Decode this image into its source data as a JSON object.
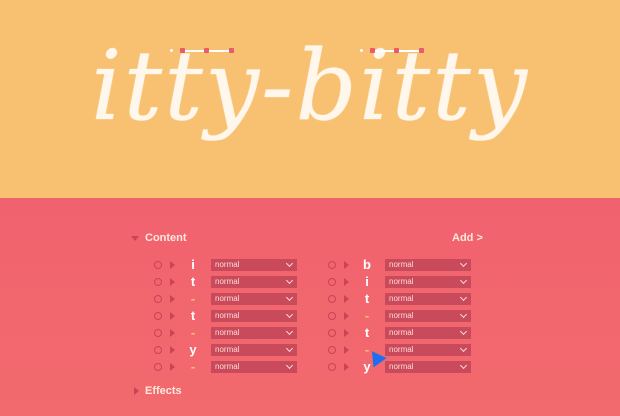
{
  "logo": {
    "text": "itty-bitty"
  },
  "content_section": {
    "label": "Content",
    "add_label": "Add >"
  },
  "effects_section": {
    "label": "Effects"
  },
  "left_rows": [
    {
      "char": "i",
      "style": "normal"
    },
    {
      "char": "t",
      "style": "normal"
    },
    {
      "char": "-",
      "style": "normal"
    },
    {
      "char": "t",
      "style": "normal"
    },
    {
      "char": "-",
      "style": "normal"
    },
    {
      "char": "y",
      "style": "normal"
    },
    {
      "char": "-",
      "style": "normal"
    }
  ],
  "right_rows": [
    {
      "char": "b",
      "style": "normal"
    },
    {
      "char": "i",
      "style": "normal"
    },
    {
      "char": "t",
      "style": "normal"
    },
    {
      "char": "-",
      "style": "normal"
    },
    {
      "char": "t",
      "style": "normal"
    },
    {
      "char": "-",
      "style": "normal"
    },
    {
      "char": "y",
      "style": "normal"
    }
  ],
  "colors": {
    "top_background": "#f8c171",
    "bottom_background": "#f1626f",
    "control_fill": "#c94a5b",
    "cursor": "#1d6ff2"
  }
}
